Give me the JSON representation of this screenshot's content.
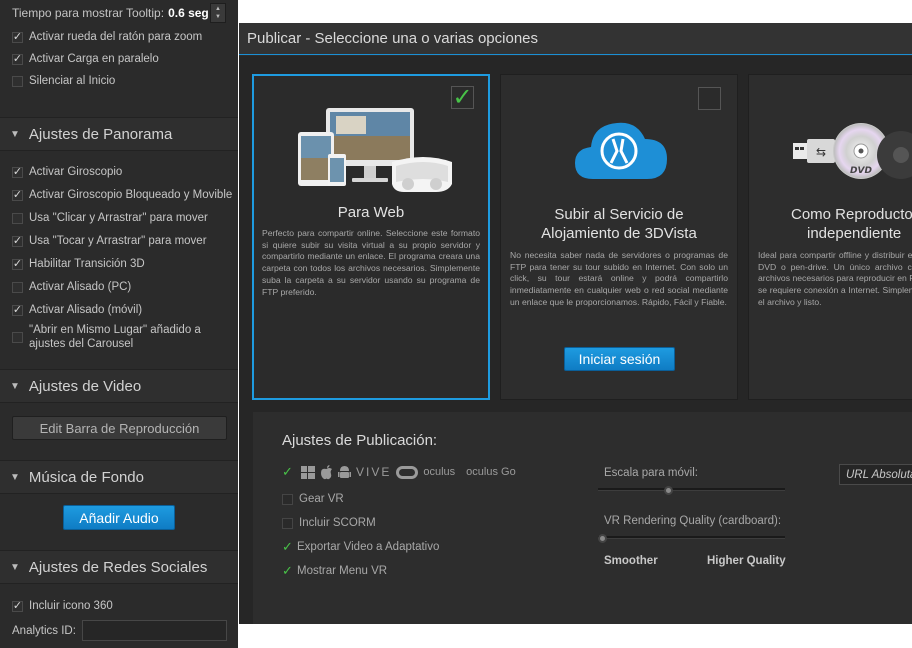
{
  "left_panel": {
    "tooltip": {
      "label": "Tiempo para mostrar Tooltip:",
      "value": "0.6 seg"
    },
    "general_options": [
      {
        "label": "Activar rueda del ratón para zoom",
        "checked": true
      },
      {
        "label": "Activar Carga en paralelo",
        "checked": true
      },
      {
        "label": "Silenciar al Inicio",
        "checked": false
      }
    ],
    "panorama_section": "Ajustes de Panorama",
    "panorama_options": [
      {
        "label": "Activar Giroscopio",
        "checked": true
      },
      {
        "label": "Activar Giroscopio Bloqueado y Movible",
        "checked": true
      },
      {
        "label": "Usa \"Clicar y Arrastrar\" para mover",
        "checked": false
      },
      {
        "label": "Usa \"Tocar y Arrastrar\" para mover",
        "checked": true
      },
      {
        "label": "Habilitar Transición 3D",
        "checked": true
      },
      {
        "label": "Activar Alisado (PC)",
        "checked": false
      },
      {
        "label": "Activar Alisado (móvil)",
        "checked": true
      }
    ],
    "carousel_option": {
      "line1": "\"Abrir en Mismo Lugar\" añadido a",
      "line2": "ajustes del Carousel",
      "checked": false
    },
    "video_section": "Ajustes de Video",
    "edit_bar_button": "Edit Barra de Reproducción",
    "music_section": "Música de Fondo",
    "add_audio_button": "Añadir Audio",
    "social_section": "Ajustes de Redes Sociales",
    "social_options": [
      {
        "label": "Incluir icono 360",
        "checked": true
      }
    ],
    "analytics_label": "Analytics ID:",
    "analytics_value": ""
  },
  "dialog": {
    "title": "Publicar - Seleccione una o varias opciones",
    "cards": [
      {
        "title": "Para Web",
        "description": "Perfecto para compartir online. Seleccione este formato si quiere subir su visita virtual a su propio servidor y compartirlo mediante un enlace. El programa creara una carpeta con todos los archivos necesarios. Simplemente suba la carpeta a su servidor usando su programa de FTP preferido.",
        "checked": true
      },
      {
        "title_line1": "Subir al Servicio de",
        "title_line2": "Alojamiento de 3DVista",
        "description": "No necesita saber nada de servidores o programas de FTP para tener su tour subido en Internet. Con solo un click, su tour estará online y podrá compartirlo inmediatamente en cualquier web o red social mediante un enlace que le proporcionamos. Rápido, Fácil y Fiable.",
        "button": "Iniciar sesión",
        "checked": false
      },
      {
        "title_line1": "Como Reproductor",
        "title_line2": "independiente",
        "description": "Ideal para compartir offline y distribuir en disco duro, DVD o pen-drive. Un único archivo con todos los archivos necesarios para reproducir en PC o Mac. No se requiere conexión a Internet. Simplemente ejecute el archivo y listo.",
        "dvd_label": "DVD"
      }
    ],
    "publish_settings": {
      "title": "Ajustes de Publicación:",
      "platforms": [
        "windows-icon",
        "apple-icon",
        "android-icon",
        "VIVE",
        "oculus",
        "oculus Go"
      ],
      "options": [
        {
          "label": "Gear VR",
          "checked": false
        },
        {
          "label": "Incluir SCORM",
          "checked": false
        },
        {
          "label": "Exportar Video a Adaptativo",
          "checked": true
        },
        {
          "label": "Mostrar Menu VR",
          "checked": true
        }
      ],
      "mobile_scale_label": "Escala para móvil:",
      "mobile_scale_value": 0.37,
      "vr_quality_label": "VR Rendering Quality (cardboard):",
      "vr_quality_value": 0.0,
      "smoother_label": "Smoother",
      "higher_quality_label": "Higher Quality",
      "url_value": "URL Absoluta"
    }
  },
  "colors": {
    "accent": "#1e9be0",
    "check_green": "#48c248",
    "panel_bg": "#2b2b2b"
  }
}
